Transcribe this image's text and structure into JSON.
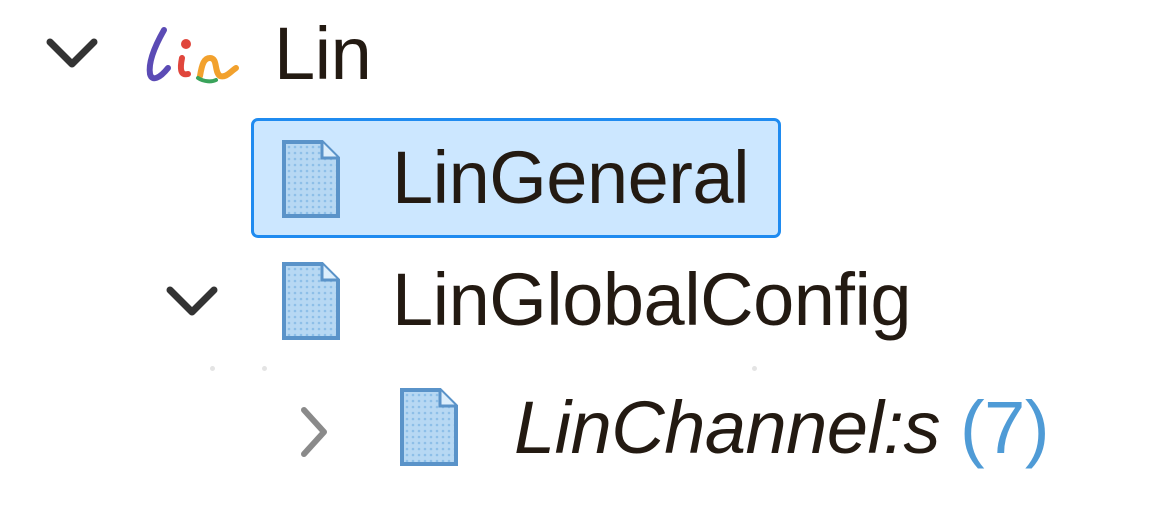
{
  "tree": {
    "root": {
      "label": "Lin",
      "logo_icon": "lin-logo-icon",
      "expanded": true,
      "twisty_icon": "chevron-down-icon"
    },
    "items": [
      {
        "label": "LinGeneral",
        "icon": "document-icon",
        "selected": true
      },
      {
        "label": "LinGlobalConfig",
        "icon": "document-icon",
        "expanded": true,
        "twisty_icon": "chevron-down-icon"
      },
      {
        "label": "LinChannel:s",
        "count": "(7)",
        "icon": "document-icon",
        "expanded": false,
        "twisty_icon": "chevron-right-icon"
      }
    ]
  },
  "colors": {
    "selection_bg": "#cce7ff",
    "selection_border": "#1f8bf0",
    "text": "#231a12",
    "count": "#4f9bd6"
  }
}
